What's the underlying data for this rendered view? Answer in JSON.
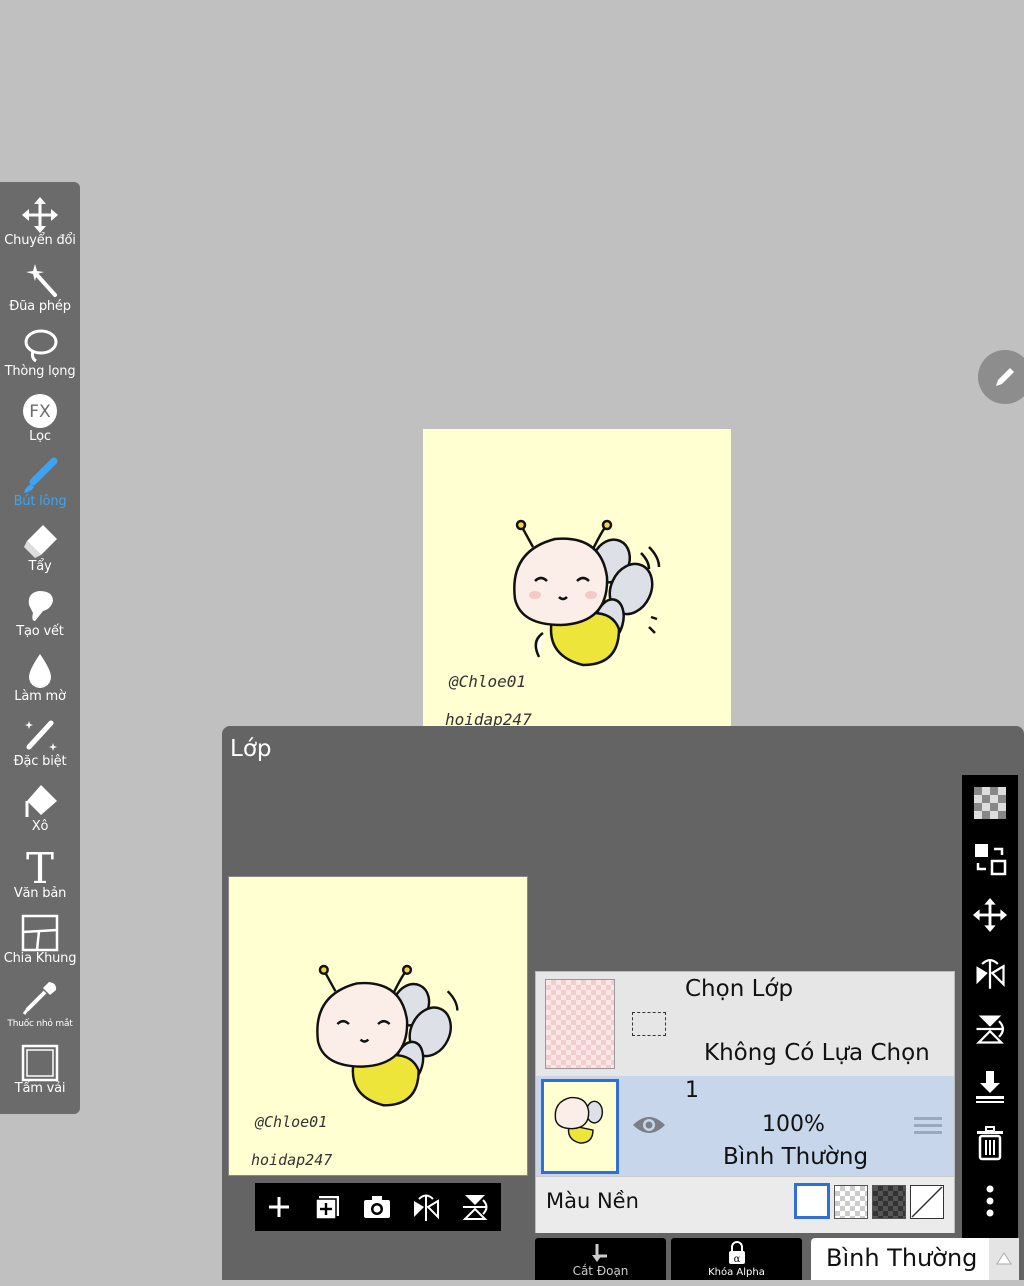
{
  "toolbar": {
    "items": [
      {
        "label": "Chuyển đổi",
        "icon": "move-icon"
      },
      {
        "label": "Đũa phép",
        "icon": "magic-wand-icon"
      },
      {
        "label": "Thòng lọng",
        "icon": "lasso-icon"
      },
      {
        "label": "Lọc",
        "icon": "fx-filter-icon"
      },
      {
        "label": "Bút lông",
        "icon": "brush-icon"
      },
      {
        "label": "Tẩy",
        "icon": "eraser-icon"
      },
      {
        "label": "Tạo vết",
        "icon": "smudge-icon"
      },
      {
        "label": "Làm mờ",
        "icon": "blur-drop-icon"
      },
      {
        "label": "Đặc biệt",
        "icon": "special-icon"
      },
      {
        "label": "Xô",
        "icon": "bucket-icon"
      },
      {
        "label": "Văn bản",
        "icon": "text-icon"
      },
      {
        "label": "Chia Khung",
        "icon": "frame-divider-icon"
      },
      {
        "label": "Thuốc nhỏ mắt",
        "icon": "eyedropper-icon"
      },
      {
        "label": "Tấm vải",
        "icon": "canvas-icon"
      }
    ],
    "active_index": 4,
    "active_color": "#3fa3ef"
  },
  "canvas": {
    "background": "#ffffd2",
    "watermark_1": "@Chloe01",
    "watermark_2": "hoidap247"
  },
  "layer_panel": {
    "title": "Lớp",
    "preview_watermark_1": "@Chloe01",
    "preview_watermark_2": "hoidap247",
    "selection_row": {
      "title": "Chọn Lớp",
      "status": "Không Có Lựa Chọn"
    },
    "layer_row": {
      "name": "1",
      "opacity": "100%",
      "blend": "Bình Thường",
      "visible": true
    },
    "background_row": {
      "label": "Màu Nền"
    },
    "bottom": {
      "clip_label": "Cắt Đoạn",
      "alpha_lock_label": "Khóa Alpha",
      "blend_mode": "Bình Thường"
    }
  }
}
